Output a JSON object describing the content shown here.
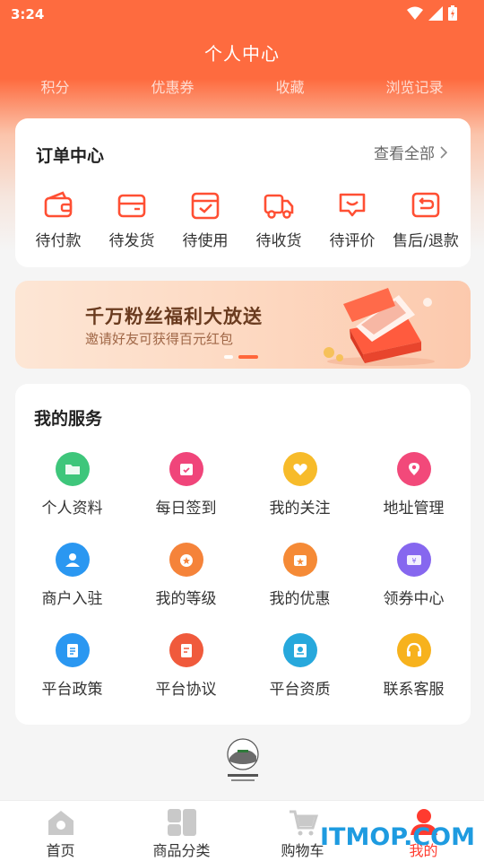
{
  "status": {
    "time": "3:24"
  },
  "header": {
    "title": "个人中心"
  },
  "stats": [
    "积分",
    "优惠券",
    "收藏",
    "浏览记录"
  ],
  "orders": {
    "title": "订单中心",
    "more": "查看全部",
    "items": [
      {
        "label": "待付款",
        "icon": "wallet-icon"
      },
      {
        "label": "待发货",
        "icon": "package-icon"
      },
      {
        "label": "待使用",
        "icon": "check-box-icon"
      },
      {
        "label": "待收货",
        "icon": "truck-icon"
      },
      {
        "label": "待评价",
        "icon": "chat-icon"
      },
      {
        "label": "售后/退款",
        "icon": "return-icon"
      }
    ]
  },
  "banner": {
    "title": "千万粉丝福利大放送",
    "subtitle": "邀请好友可获得百元红包",
    "slide_count": 2,
    "active_slide": 2
  },
  "services": {
    "title": "我的服务",
    "items": [
      {
        "label": "个人资料",
        "icon": "folder-icon",
        "color": "#3ec67b"
      },
      {
        "label": "每日签到",
        "icon": "calendar-icon",
        "color": "#f0457a"
      },
      {
        "label": "我的关注",
        "icon": "heart-icon",
        "color": "#f7bb2a"
      },
      {
        "label": "地址管理",
        "icon": "location-icon",
        "color": "#f2497a"
      },
      {
        "label": "商户入驻",
        "icon": "user-icon",
        "color": "#2a97f1"
      },
      {
        "label": "我的等级",
        "icon": "medal-icon",
        "color": "#f5833a"
      },
      {
        "label": "我的优惠",
        "icon": "coupon-icon",
        "color": "#f58a36"
      },
      {
        "label": "领券中心",
        "icon": "ticket-icon",
        "color": "#8667ef"
      },
      {
        "label": "平台政策",
        "icon": "document-icon",
        "color": "#2a97f1"
      },
      {
        "label": "平台协议",
        "icon": "agreement-icon",
        "color": "#f05a3c"
      },
      {
        "label": "平台资质",
        "icon": "certificate-icon",
        "color": "#27a8dc"
      },
      {
        "label": "联系客服",
        "icon": "headset-icon",
        "color": "#f7b21d"
      }
    ]
  },
  "tabs": [
    {
      "label": "首页",
      "icon": "home-icon"
    },
    {
      "label": "商品分类",
      "icon": "category-icon"
    },
    {
      "label": "购物车",
      "icon": "cart-icon"
    },
    {
      "label": "我的",
      "icon": "profile-icon"
    }
  ],
  "watermark": "ITMOP.COM",
  "colors": {
    "primary": "#fe6b3f",
    "accent": "#ff3b2f"
  }
}
